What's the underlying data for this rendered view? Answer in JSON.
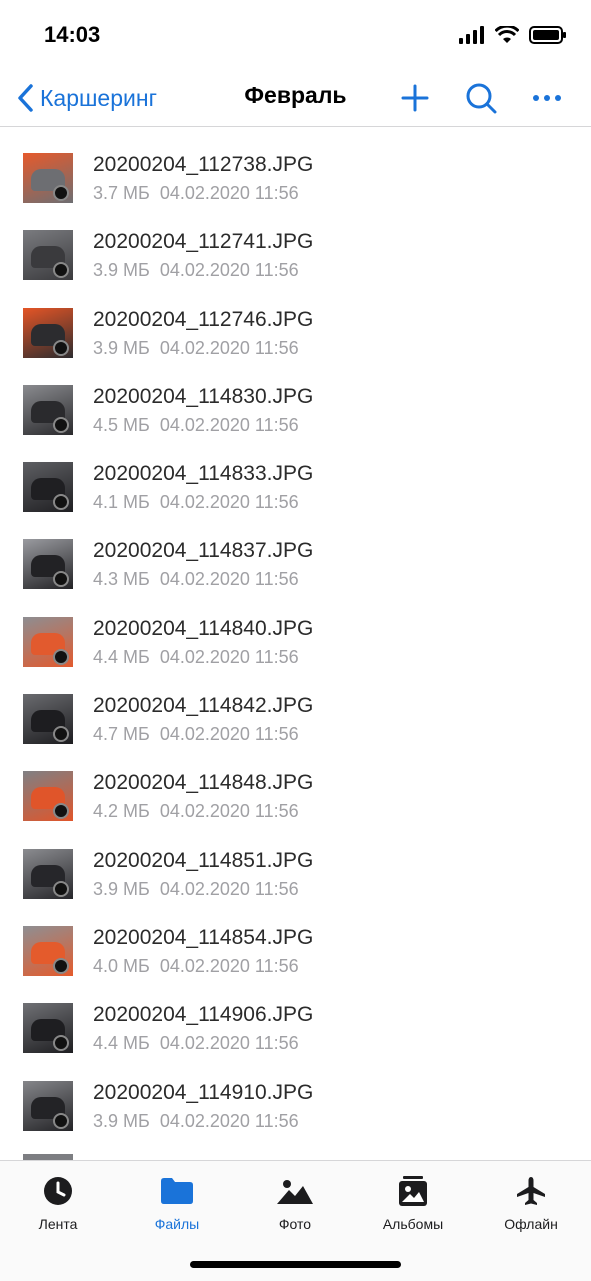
{
  "status_bar": {
    "time": "14:03"
  },
  "nav": {
    "back_label": "Каршеринг",
    "title": "Февраль",
    "icons": [
      "plus-icon",
      "search-icon",
      "more-icon"
    ]
  },
  "files": [
    {
      "name": "20200204_112738.JPG",
      "size": "3.7 МБ",
      "date": "04.02.2020 11:56",
      "thumb_colors": [
        "#e65a2c",
        "#6d6e72"
      ]
    },
    {
      "name": "20200204_112741.JPG",
      "size": "3.9 МБ",
      "date": "04.02.2020 11:56",
      "thumb_colors": [
        "#7a7b7f",
        "#3a3a3d"
      ]
    },
    {
      "name": "20200204_112746.JPG",
      "size": "3.9 МБ",
      "date": "04.02.2020 11:56",
      "thumb_colors": [
        "#e55526",
        "#2c2c2f"
      ]
    },
    {
      "name": "20200204_114830.JPG",
      "size": "4.5 МБ",
      "date": "04.02.2020 11:56",
      "thumb_colors": [
        "#8a8b8f",
        "#2a2a2d"
      ]
    },
    {
      "name": "20200204_114833.JPG",
      "size": "4.1 МБ",
      "date": "04.02.2020 11:56",
      "thumb_colors": [
        "#5e5f63",
        "#1f1f22"
      ]
    },
    {
      "name": "20200204_114837.JPG",
      "size": "4.3 МБ",
      "date": "04.02.2020 11:56",
      "thumb_colors": [
        "#9a9ba0",
        "#222225"
      ]
    },
    {
      "name": "20200204_114840.JPG",
      "size": "4.4 МБ",
      "date": "04.02.2020 11:56",
      "thumb_colors": [
        "#8d8e92",
        "#e25a2e"
      ]
    },
    {
      "name": "20200204_114842.JPG",
      "size": "4.7 МБ",
      "date": "04.02.2020 11:56",
      "thumb_colors": [
        "#6a6b6f",
        "#1d1d20"
      ]
    },
    {
      "name": "20200204_114848.JPG",
      "size": "4.2 МБ",
      "date": "04.02.2020 11:56",
      "thumb_colors": [
        "#7f8084",
        "#e0552a"
      ]
    },
    {
      "name": "20200204_114851.JPG",
      "size": "3.9 МБ",
      "date": "04.02.2020 11:56",
      "thumb_colors": [
        "#8b8c90",
        "#26262a"
      ]
    },
    {
      "name": "20200204_114854.JPG",
      "size": "4.0 МБ",
      "date": "04.02.2020 11:56",
      "thumb_colors": [
        "#8e8f93",
        "#e45b2c"
      ]
    },
    {
      "name": "20200204_114906.JPG",
      "size": "4.4 МБ",
      "date": "04.02.2020 11:56",
      "thumb_colors": [
        "#707175",
        "#1e1e21"
      ]
    },
    {
      "name": "20200204_114910.JPG",
      "size": "3.9 МБ",
      "date": "04.02.2020 11:56",
      "thumb_colors": [
        "#85868a",
        "#232326"
      ]
    }
  ],
  "tabs": [
    {
      "label": "Лента",
      "icon": "clock-icon",
      "active": false
    },
    {
      "label": "Файлы",
      "icon": "folder-icon",
      "active": true
    },
    {
      "label": "Фото",
      "icon": "photo-icon",
      "active": false
    },
    {
      "label": "Альбомы",
      "icon": "album-icon",
      "active": false
    },
    {
      "label": "Офлайн",
      "icon": "airplane-icon",
      "active": false
    }
  ],
  "colors": {
    "accent": "#1a73d9",
    "meta_text": "#a0a0a4",
    "divider": "#d6d6d8"
  }
}
